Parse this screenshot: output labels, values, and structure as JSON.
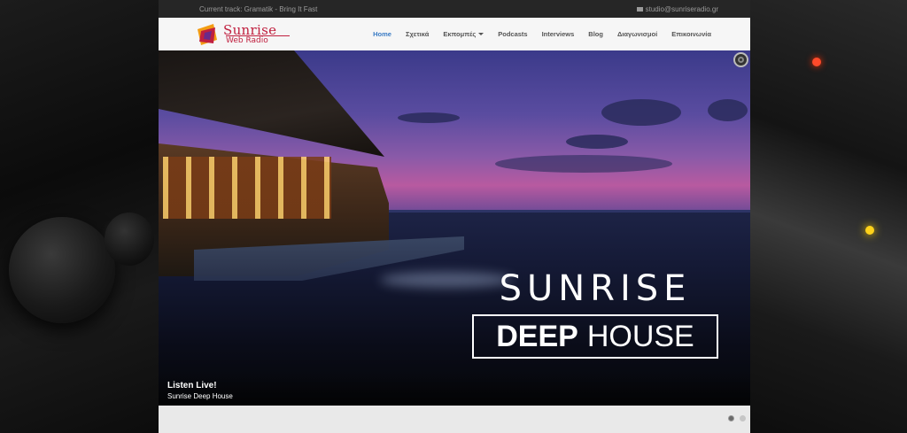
{
  "topbar": {
    "track": "Current track: Gramatik - Bring It Fast",
    "email": "studio@sunriseradio.gr",
    "email_icon": "envelope-icon"
  },
  "logo": {
    "line1": "Sunrise",
    "line2": "Web Radio",
    "colors": {
      "brand": "#c0203f",
      "orange": "#f39c12",
      "purple": "#6a2a8a"
    }
  },
  "nav": {
    "items": [
      {
        "label": "Home",
        "active": true
      },
      {
        "label": "Σχετικά"
      },
      {
        "label": "Εκπομπές",
        "dropdown": true
      },
      {
        "label": "Podcasts"
      },
      {
        "label": "Interviews"
      },
      {
        "label": "Blog"
      },
      {
        "label": "Διαγωνισμοί"
      },
      {
        "label": "Επικοινωνία"
      }
    ],
    "active_color": "#3a7bc4"
  },
  "slider": {
    "title_line1": "SUNRISE",
    "title_box_bold": "DEEP",
    "title_box_normal": "HOUSE",
    "caption_title": "Listen Live!",
    "caption_sub": "Sunrise Deep House",
    "pause_icon": "slider-pause-icon",
    "total_slides": 2,
    "current_slide": 1
  }
}
